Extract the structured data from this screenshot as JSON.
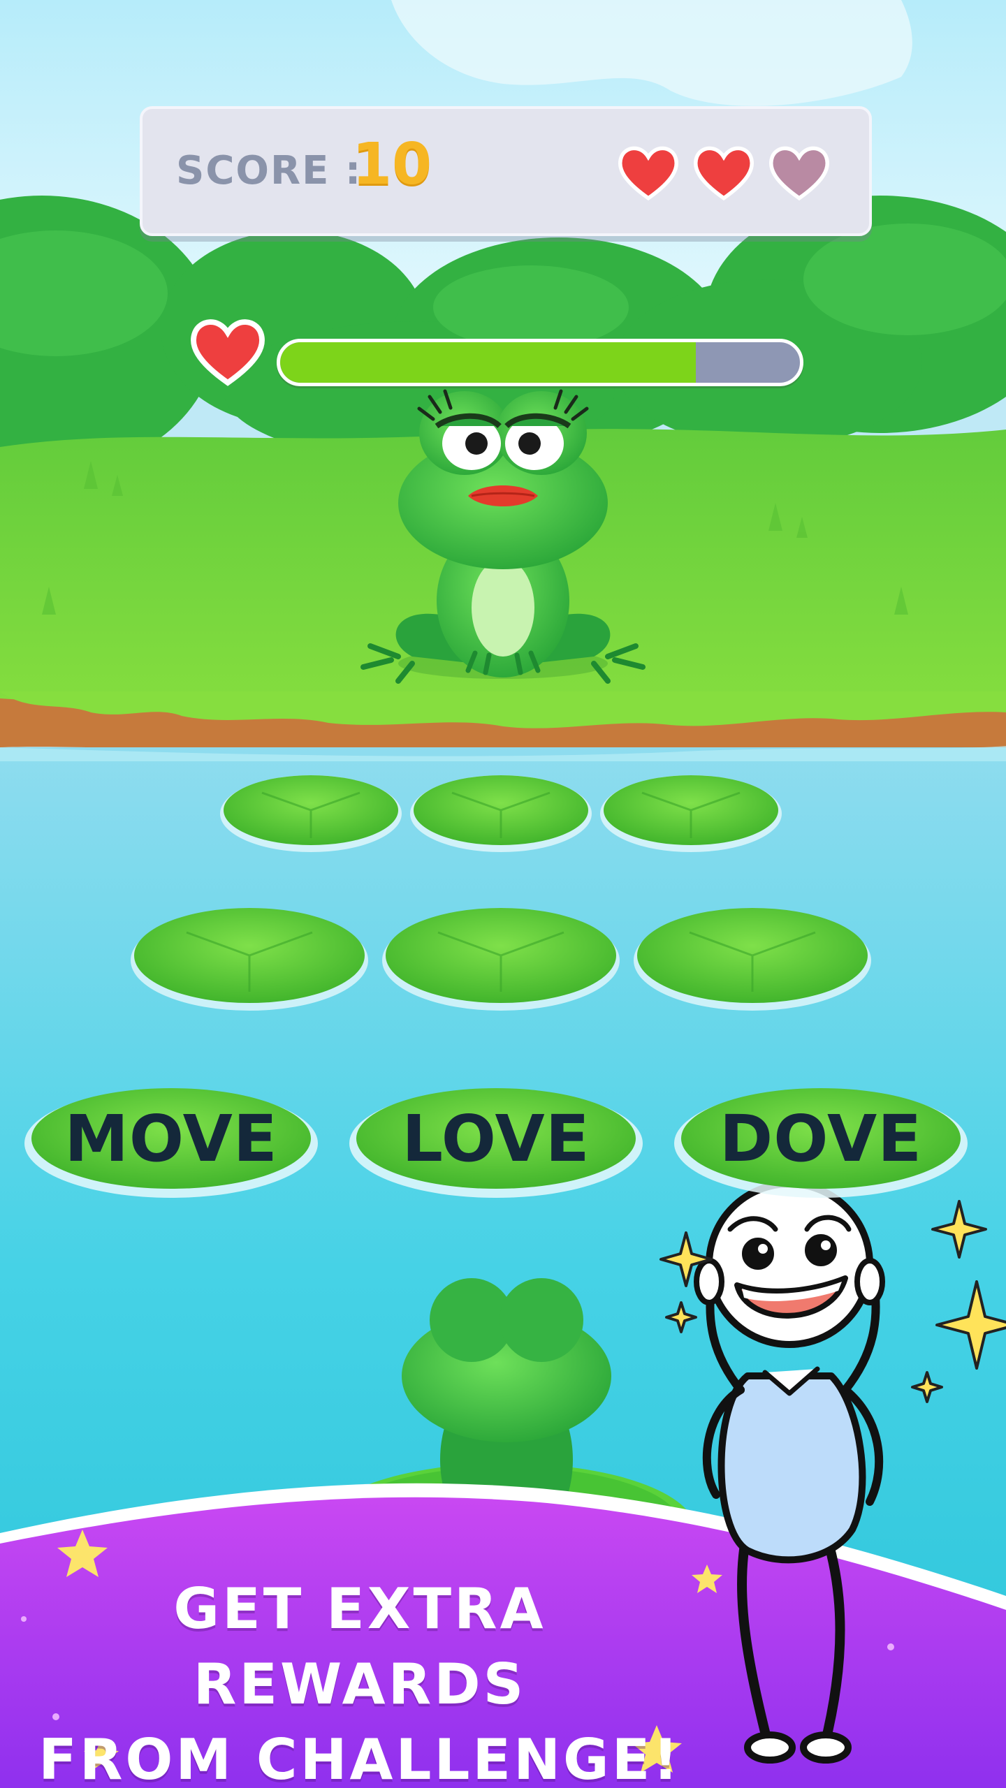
{
  "hud": {
    "score_label": "SCORE :",
    "score_value": "10",
    "lives": {
      "total": 3,
      "remaining": 2
    }
  },
  "enemy_health": {
    "fraction": 0.8
  },
  "word_choices": [
    {
      "label": "MOVE"
    },
    {
      "label": "LOVE"
    },
    {
      "label": "DOVE"
    }
  ],
  "promo": {
    "line1": "GET EXTRA REWARDS",
    "line2": "FROM CHALLENGE!"
  },
  "colors": {
    "heart_full": "#ee3f3f",
    "heart_empty": "#b98aa3",
    "score": "#f6b623",
    "banner": "#9d36ee",
    "health_fill": "#7dd41a"
  },
  "icons": [
    "heart-icon",
    "sparkle-icon",
    "star-icon"
  ]
}
